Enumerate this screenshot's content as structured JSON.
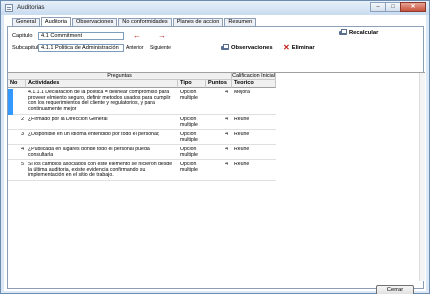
{
  "window": {
    "title": "Auditorias"
  },
  "tabs": [
    "General",
    "Auditoria",
    "Observaciones",
    "No conformidades",
    "Planes de accion",
    "Resumen"
  ],
  "form": {
    "capitulo_label": "Capitulo",
    "capitulo_value": "4.1  Commitment",
    "subcapitulo_label": "Subcapitulo",
    "subcapitulo_value": "4.1.1 Politica de Administración",
    "anterior_label": "Anterior",
    "siguiente_label": "Siguiente"
  },
  "actions": {
    "recalcular": "Recalcular",
    "observaciones": "Observaciones",
    "eliminar": "Eliminar"
  },
  "grid": {
    "group_preguntas": "Preguntas",
    "group_calificacion": "Calificacion Inicial",
    "columns": [
      "No",
      "Actividades",
      "Tipo",
      "Puntos",
      "Teorico"
    ],
    "rows": [
      {
        "no": "",
        "actividad": "4.1.1.1 Declaración de la política = delinear compromiso para proveer elmiento seguro, definir metodos usados para cumplir con los requerimientos del cliente y regulatorios, y para continuamente mejor",
        "tipo": "Opción multiple",
        "puntos": "4",
        "teorico": "Mejora"
      },
      {
        "no": "2",
        "actividad": "¿Firmado por la Direccion General",
        "tipo": "Opción multiple",
        "puntos": "4",
        "teorico": "Reune"
      },
      {
        "no": "3",
        "actividad": "¿Disponible en un idioma entendido por todo el personal;",
        "tipo": "Opción multiple",
        "puntos": "4",
        "teorico": "Reune"
      },
      {
        "no": "4",
        "actividad": "¿Publicada en lugares donde todo el personal pueda consultarla",
        "tipo": "Opción multiple",
        "puntos": "4",
        "teorico": "Reune"
      },
      {
        "no": "5",
        "actividad": "Si los cambios asociados con este elemento se hicieron desde la última auditoria, existe evidencia confirmando su implementación en el sitio de trabajo.",
        "tipo": "Opción multiple",
        "puntos": "4",
        "teorico": "Reune"
      }
    ]
  },
  "footer": {
    "cerrar": "Cerrar"
  }
}
